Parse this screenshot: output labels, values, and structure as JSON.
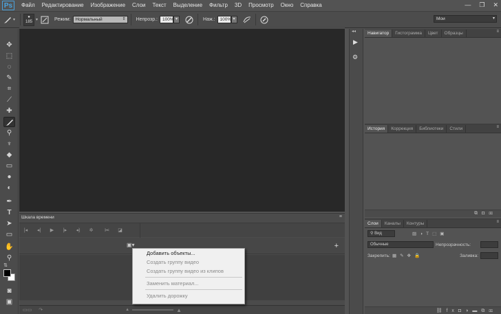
{
  "app": {
    "logo": "Ps"
  },
  "menu": [
    "Файл",
    "Редактирование",
    "Изображение",
    "Слои",
    "Текст",
    "Выделение",
    "Фильтр",
    "3D",
    "Просмотр",
    "Окно",
    "Справка"
  ],
  "options": {
    "brush_size": "185",
    "mode_label": "Режим:",
    "mode_value": "Нормальный",
    "opacity_label": "Непрозр.:",
    "opacity_value": "100%",
    "flow_label": "Наж.:",
    "flow_value": "100%",
    "workspace": "Мои"
  },
  "timeline": {
    "tab": "Шкала времени"
  },
  "context_menu": [
    {
      "label": "Добавить объекты...",
      "enabled": true
    },
    {
      "label": "Создать группу видео",
      "enabled": false
    },
    {
      "label": "Создать группу видео из клипов",
      "enabled": false
    },
    {
      "label": "Заменить материал...",
      "enabled": false
    },
    {
      "label": "Удалить дорожку",
      "enabled": false
    }
  ],
  "panels": {
    "navigator_tabs": [
      "Навигатор",
      "Гистограмма",
      "Цвет",
      "Образцы"
    ],
    "history_tabs": [
      "История",
      "Коррекция",
      "Библиотеки",
      "Стили"
    ],
    "layers_tabs": [
      "Слои",
      "Каналы",
      "Контуры"
    ],
    "layers": {
      "kind": "Вид",
      "blend": "Обычные",
      "opacity_label": "Непрозрачность:",
      "lock_label": "Закрепить:",
      "fill_label": "Заливка:"
    }
  }
}
